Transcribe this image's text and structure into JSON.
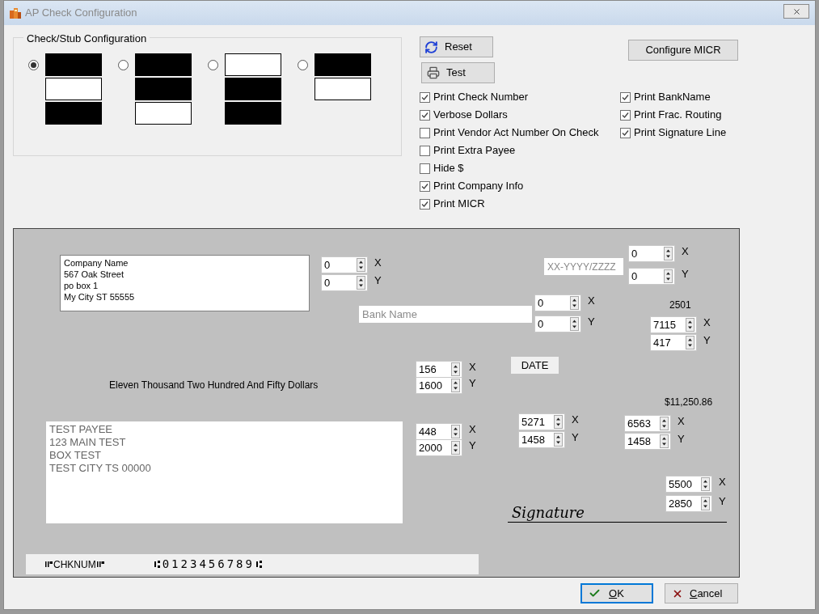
{
  "window": {
    "title": "AP Check Configuration"
  },
  "stub_config": {
    "title": "Check/Stub Configuration",
    "options": [
      {
        "selected": true,
        "blocks": [
          {
            "filled": true
          },
          {
            "filled": false
          },
          {
            "filled": true
          }
        ]
      },
      {
        "selected": false,
        "blocks": [
          {
            "filled": true
          },
          {
            "filled": true
          },
          {
            "filled": false
          }
        ]
      },
      {
        "selected": false,
        "blocks": [
          {
            "filled": false
          },
          {
            "filled": true
          },
          {
            "filled": true
          }
        ]
      },
      {
        "selected": false,
        "blocks": [
          {
            "filled": true
          },
          {
            "filled": false
          }
        ]
      }
    ]
  },
  "buttons": {
    "reset": "Reset",
    "test": "Test",
    "configure_micr": "Configure MICR"
  },
  "options_left": [
    {
      "label": "Print Check Number",
      "checked": true
    },
    {
      "label": "Verbose Dollars",
      "checked": true
    },
    {
      "label": "Print Vendor Act Number On Check",
      "checked": false
    },
    {
      "label": "Print Extra Payee",
      "checked": false
    },
    {
      "label": "Hide $",
      "checked": false
    },
    {
      "label": "Print Company Info",
      "checked": true
    },
    {
      "label": "Print MICR",
      "checked": true
    }
  ],
  "options_right": [
    {
      "label": "Print BankName",
      "checked": true
    },
    {
      "label": "Print Frac. Routing",
      "checked": true
    },
    {
      "label": "Print Signature Line",
      "checked": true
    }
  ],
  "check_layout": {
    "company_info": {
      "lines": [
        "Company Name",
        "567 Oak Street",
        "po box 1",
        "My City ST 55555"
      ],
      "x": {
        "value": "0",
        "label": "X"
      },
      "y": {
        "value": "0",
        "label": "Y"
      }
    },
    "frac_routing": {
      "placeholder": "XX-YYYY/ZZZZ",
      "x": {
        "value": "0",
        "label": "X"
      },
      "y": {
        "value": "0",
        "label": "Y"
      }
    },
    "bank_name": {
      "placeholder": "Bank Name",
      "x": {
        "value": "0",
        "label": "X"
      },
      "y": {
        "value": "0",
        "label": "Y"
      }
    },
    "check_number": {
      "text": "2501",
      "x": {
        "value": "7115",
        "label": "X"
      },
      "y": {
        "value": "417",
        "label": "Y"
      }
    },
    "date": {
      "text": "DATE",
      "x": {
        "value": "5271",
        "label": "X"
      },
      "y": {
        "value": "1458",
        "label": "Y"
      }
    },
    "amount_words": {
      "text": "Eleven Thousand Two Hundred And Fifty Dollars",
      "x": {
        "value": "156",
        "label": "X"
      },
      "y": {
        "value": "1600",
        "label": "Y"
      }
    },
    "amount": {
      "text": "$11,250.86",
      "x": {
        "value": "6563",
        "label": "X"
      },
      "y": {
        "value": "1458",
        "label": "Y"
      }
    },
    "payee": {
      "lines": [
        "TEST PAYEE",
        "123 MAIN TEST",
        "BOX TEST",
        "TEST CITY TS 00000"
      ],
      "x": {
        "value": "448",
        "label": "X"
      },
      "y": {
        "value": "2000",
        "label": "Y"
      }
    },
    "signature": {
      "text": "Signature",
      "x": {
        "value": "5500",
        "label": "X"
      },
      "y": {
        "value": "2850",
        "label": "Y"
      }
    },
    "micr": {
      "check_number": "CHKNUM",
      "routing": "0123456789"
    }
  },
  "footer": {
    "ok": "OK",
    "cancel": "Cancel"
  }
}
